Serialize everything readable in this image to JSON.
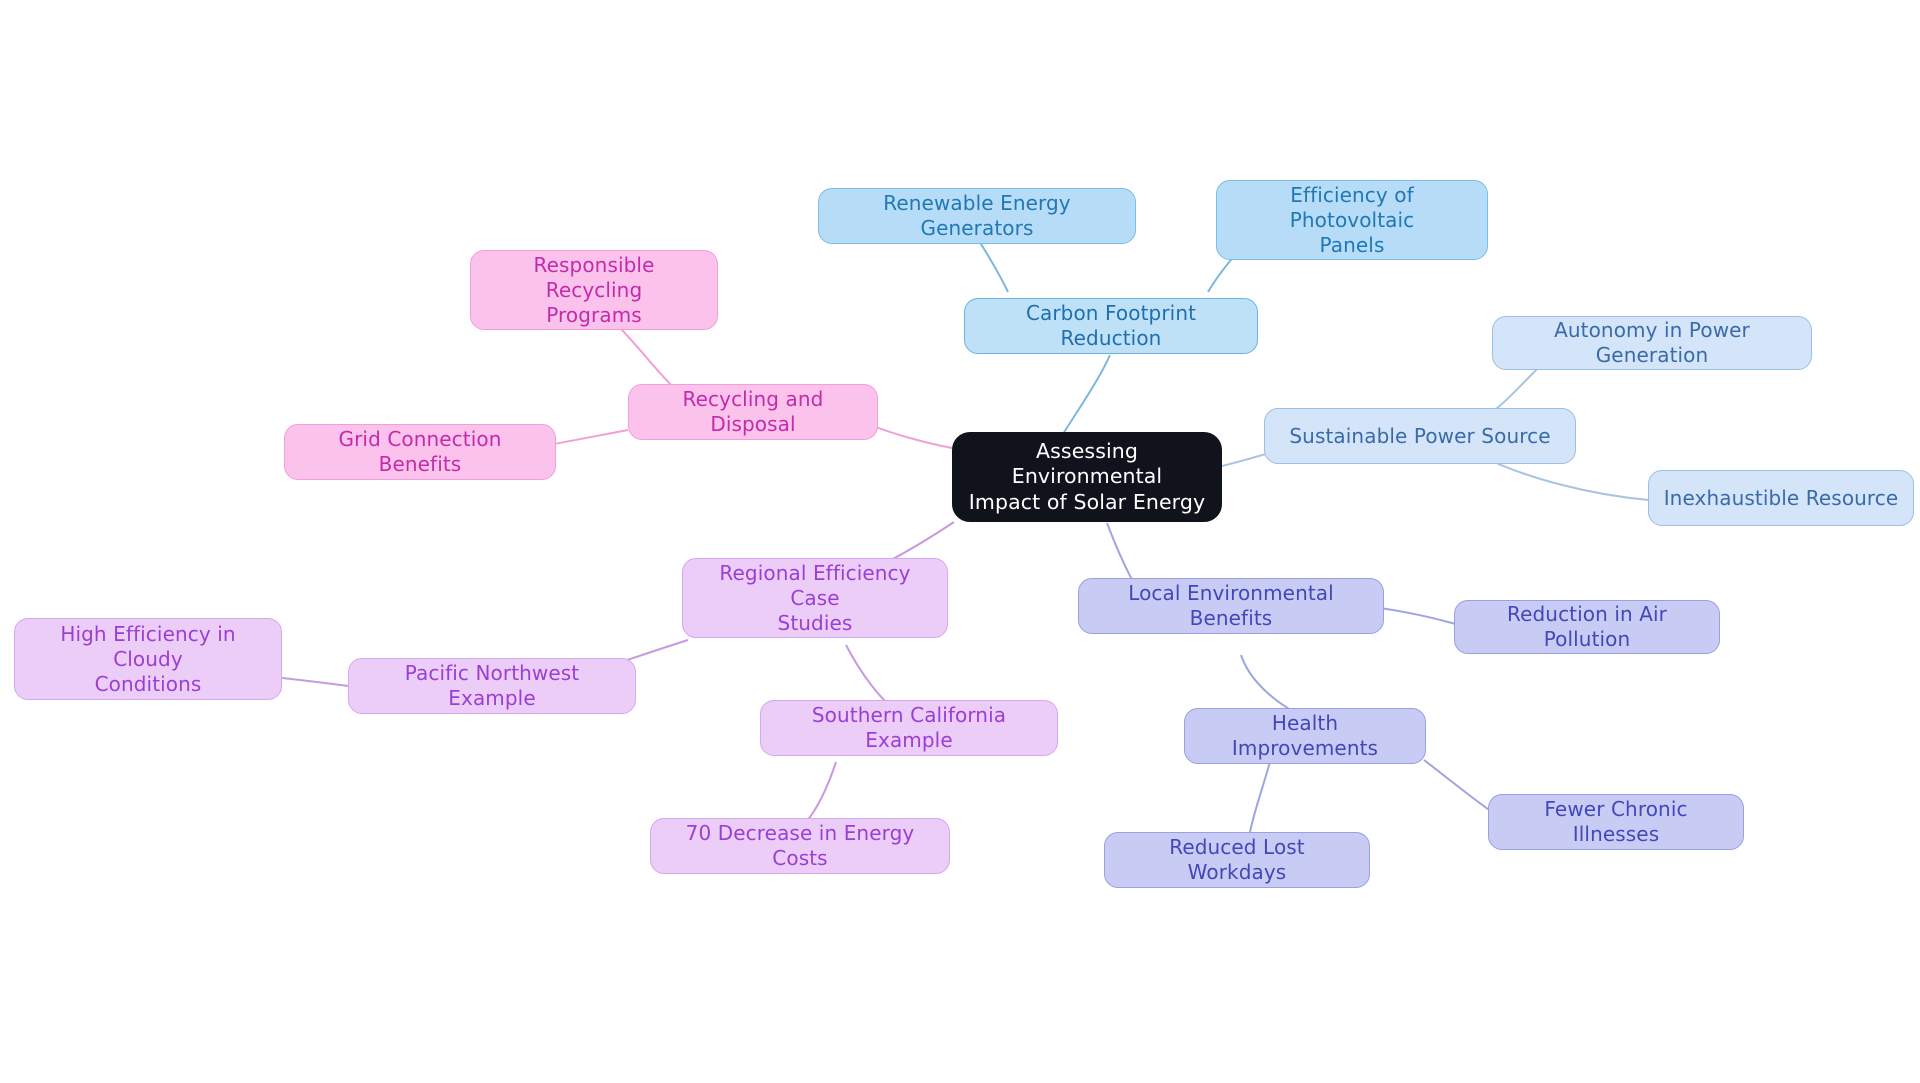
{
  "diagram": {
    "type": "mindmap",
    "title": "Assessing Environmental Impact of Solar Energy",
    "background_color": "#ffffff",
    "root": {
      "label": "Assessing Environmental\nImpact of Solar Energy",
      "fill": "#10131c",
      "text_color": "#ffffff"
    },
    "branches": [
      {
        "id": "carbon-footprint-reduction",
        "label": "Carbon Footprint Reduction",
        "fill": "#bfe1f8",
        "stroke": "#6ab3e0",
        "text_color": "#1f6fae",
        "children": [
          {
            "id": "renewable-energy-generators",
            "label": "Renewable Energy Generators"
          },
          {
            "id": "efficiency-of-photovoltaic-panels",
            "label": "Efficiency of Photovoltaic\nPanels"
          }
        ]
      },
      {
        "id": "sustainable-power-source",
        "label": "Sustainable Power Source",
        "fill": "#d4e4f9",
        "stroke": "#9cc0e4",
        "text_color": "#3a6ba8",
        "children": [
          {
            "id": "autonomy-in-power-generation",
            "label": "Autonomy in Power Generation"
          },
          {
            "id": "inexhaustible-resource",
            "label": "Inexhaustible Resource"
          }
        ]
      },
      {
        "id": "local-environmental-benefits",
        "label": "Local Environmental Benefits",
        "fill": "#c8cbf3",
        "stroke": "#9a9fe0",
        "text_color": "#4348b8",
        "children": [
          {
            "id": "reduction-in-air-pollution",
            "label": "Reduction in Air Pollution"
          },
          {
            "id": "health-improvements",
            "label": "Health Improvements",
            "children": [
              {
                "id": "fewer-chronic-illnesses",
                "label": "Fewer Chronic Illnesses"
              },
              {
                "id": "reduced-lost-workdays",
                "label": "Reduced Lost Workdays"
              }
            ]
          }
        ]
      },
      {
        "id": "regional-efficiency-case-studies",
        "label": "Regional Efficiency Case\nStudies",
        "fill": "#ebcdf8",
        "stroke": "#d5a8ef",
        "text_color": "#9b3fd4",
        "children": [
          {
            "id": "pacific-northwest-example",
            "label": "Pacific Northwest Example",
            "children": [
              {
                "id": "high-efficiency-in-cloudy-conditions",
                "label": "High Efficiency in Cloudy\nConditions"
              }
            ]
          },
          {
            "id": "southern-california-example",
            "label": "Southern California Example",
            "children": [
              {
                "id": "70-decrease-in-energy-costs",
                "label": "70 Decrease in Energy Costs"
              }
            ]
          }
        ]
      },
      {
        "id": "recycling-and-disposal",
        "label": "Recycling and Disposal",
        "fill": "#fbc3ec",
        "stroke": "#f29ede",
        "text_color": "#c32bab",
        "children": [
          {
            "id": "responsible-recycling-programs",
            "label": "Responsible Recycling\nPrograms"
          },
          {
            "id": "grid-connection-benefits",
            "label": "Grid Connection Benefits"
          }
        ]
      }
    ],
    "nodes": {
      "root": {
        "text": "Assessing Environmental\nImpact of Solar Energy"
      },
      "carbon_footprint_reduction": {
        "text": "Carbon Footprint Reduction"
      },
      "renewable_energy_generators": {
        "text": "Renewable Energy Generators"
      },
      "efficiency_of_photovoltaic_panels": {
        "text": "Efficiency of Photovoltaic\nPanels"
      },
      "sustainable_power_source": {
        "text": "Sustainable Power Source"
      },
      "autonomy_in_power_generation": {
        "text": "Autonomy in Power Generation"
      },
      "inexhaustible_resource": {
        "text": "Inexhaustible Resource"
      },
      "local_environmental_benefits": {
        "text": "Local Environmental Benefits"
      },
      "reduction_in_air_pollution": {
        "text": "Reduction in Air Pollution"
      },
      "health_improvements": {
        "text": "Health Improvements"
      },
      "fewer_chronic_illnesses": {
        "text": "Fewer Chronic Illnesses"
      },
      "reduced_lost_workdays": {
        "text": "Reduced Lost Workdays"
      },
      "regional_efficiency_case_studies": {
        "text": "Regional Efficiency Case\nStudies"
      },
      "pacific_northwest_example": {
        "text": "Pacific Northwest Example"
      },
      "high_efficiency_in_cloudy_conditions": {
        "text": "High Efficiency in Cloudy\nConditions"
      },
      "southern_california_example": {
        "text": "Southern California Example"
      },
      "70_decrease_in_energy_costs": {
        "text": "70 Decrease in Energy Costs"
      },
      "recycling_and_disposal": {
        "text": "Recycling and Disposal"
      },
      "responsible_recycling_programs": {
        "text": "Responsible Recycling\nPrograms"
      },
      "grid_connection_benefits": {
        "text": "Grid Connection Benefits"
      }
    },
    "edge_colors": {
      "cyan": "#7cb8dd",
      "steel": "#a7c3e0",
      "periwinkle": "#a0a4e0",
      "violet": "#c79ae0",
      "pink": "#f0a0d8"
    }
  }
}
